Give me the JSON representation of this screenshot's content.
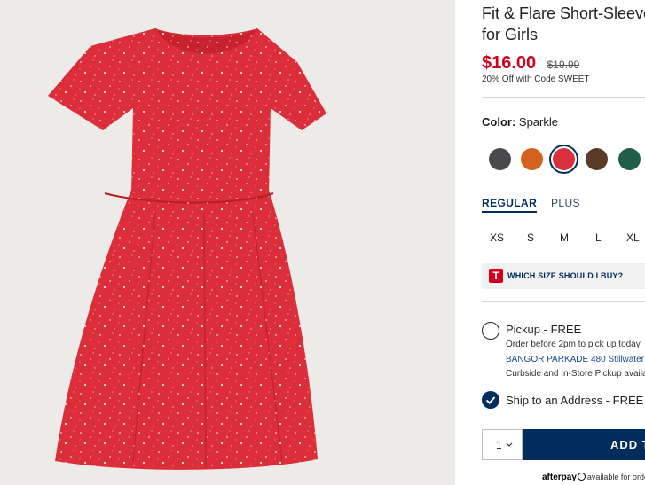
{
  "product": {
    "title_line1": "Fit & Flare Short-Sleeve",
    "title_line2": "for Girls",
    "image_alt": "Red sparkle fit & flare short-sleeve dress"
  },
  "price": {
    "sale": "$16.00",
    "original": "$19.99",
    "promo": "20% Off with Code SWEET"
  },
  "color": {
    "label": "Color:",
    "value": "Sparkle",
    "swatches": [
      {
        "name": "charcoal-dots",
        "color": "#4a4a4c"
      },
      {
        "name": "orange-floral",
        "color": "#d4611d"
      },
      {
        "name": "red-sparkle",
        "color": "#d8303c"
      },
      {
        "name": "leopard",
        "color": "#5b3a28"
      },
      {
        "name": "green-plaid",
        "color": "#1f5f4a"
      }
    ]
  },
  "fit": {
    "tabs": [
      "REGULAR",
      "PLUS"
    ],
    "selected": "REGULAR"
  },
  "sizes": [
    "XS",
    "S",
    "M",
    "L",
    "XL"
  ],
  "size_help": {
    "badge": "T",
    "label": "WHICH SIZE SHOULD I BUY?"
  },
  "fulfillment": {
    "pickup": {
      "title": "Pickup - FREE",
      "line1": "Order before 2pm to pick up today",
      "store": "BANGOR PARKADE 480 Stillwater",
      "line3": "Curbside and In-Store Pickup available"
    },
    "ship": {
      "title": "Ship to an Address - FREE"
    }
  },
  "cart": {
    "quantity": "1",
    "add_label": "ADD TO BAG"
  },
  "afterpay": {
    "brand": "afterpay",
    "text": "available for orders"
  },
  "colors": {
    "accent_navy": "#002d5c",
    "sale_red": "#d0021b",
    "dress_red": "#dc2d3a",
    "image_bg": "#ecebe8"
  }
}
